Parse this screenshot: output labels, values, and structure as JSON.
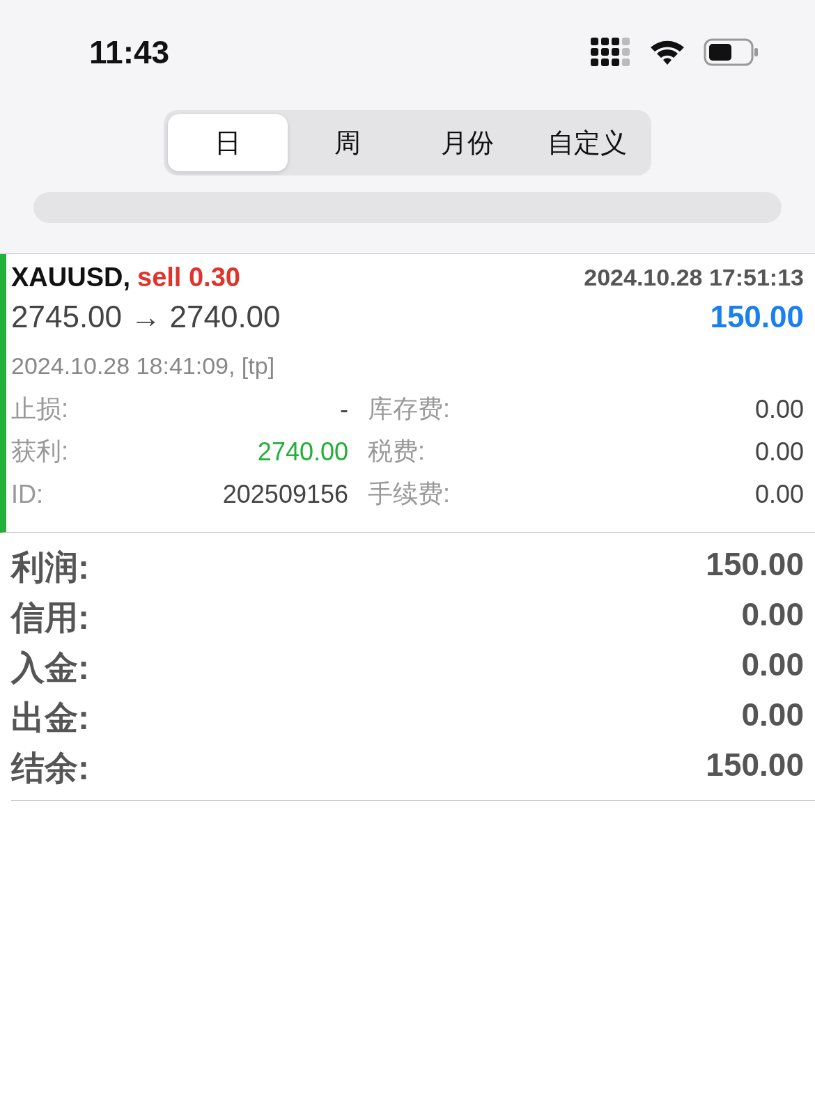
{
  "status_bar": {
    "time": "11:43"
  },
  "tabs": [
    {
      "label": "日",
      "selected": true
    },
    {
      "label": "周",
      "selected": false
    },
    {
      "label": "月份",
      "selected": false
    },
    {
      "label": "自定义",
      "selected": false
    }
  ],
  "trade": {
    "symbol": "XAUUSD,",
    "side": "sell 0.30",
    "open_time": "2024.10.28 17:51:13",
    "prices": "2745.00 → 2740.00",
    "profit": "150.00",
    "close_info": "2024.10.28 18:41:09, [tp]",
    "details": [
      {
        "label": "止损:",
        "value": "-",
        "kind": "plain",
        "right_label": "库存费:",
        "right_value": "0.00"
      },
      {
        "label": "获利:",
        "value": "2740.00",
        "kind": "positive",
        "right_label": "税费:",
        "right_value": "0.00"
      },
      {
        "label": "ID:",
        "value": "202509156",
        "kind": "plain",
        "right_label": "手续费:",
        "right_value": "0.00"
      }
    ]
  },
  "summary": [
    {
      "label": "利润:",
      "value": "150.00"
    },
    {
      "label": "信用:",
      "value": "0.00"
    },
    {
      "label": "入金:",
      "value": "0.00"
    },
    {
      "label": "出金:",
      "value": "0.00"
    },
    {
      "label": "结余:",
      "value": "150.00"
    }
  ]
}
